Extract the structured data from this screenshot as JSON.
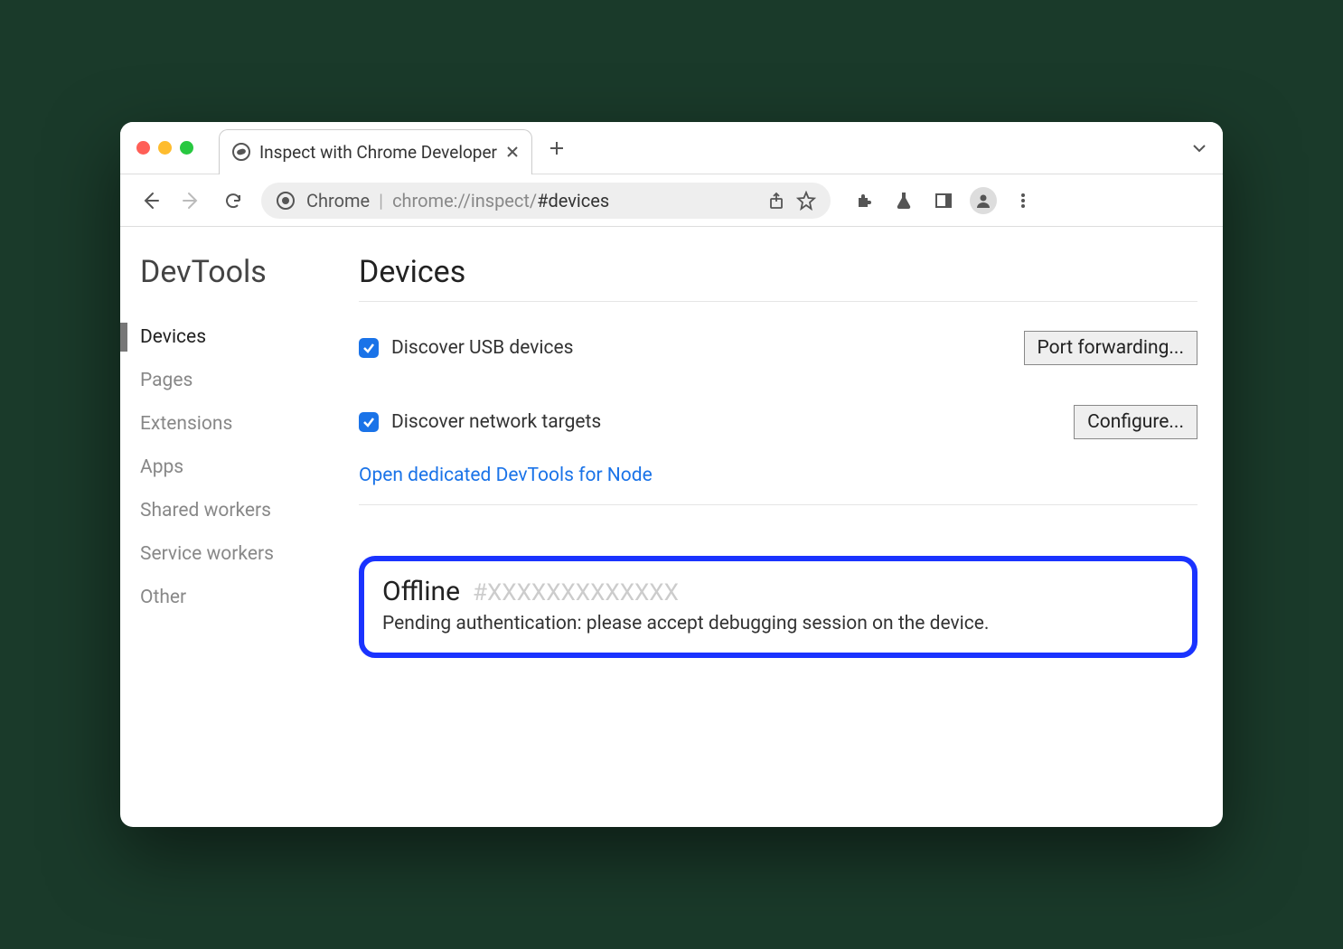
{
  "tab": {
    "title": "Inspect with Chrome Developer"
  },
  "omnibox": {
    "label": "Chrome",
    "url_main": "chrome://inspect/",
    "url_hash": "#devices"
  },
  "sidebar": {
    "title": "DevTools",
    "items": [
      {
        "label": "Devices",
        "active": true
      },
      {
        "label": "Pages"
      },
      {
        "label": "Extensions"
      },
      {
        "label": "Apps"
      },
      {
        "label": "Shared workers"
      },
      {
        "label": "Service workers"
      },
      {
        "label": "Other"
      }
    ]
  },
  "main": {
    "title": "Devices",
    "discover_usb": {
      "label": "Discover USB devices",
      "checked": true,
      "button": "Port forwarding..."
    },
    "discover_network": {
      "label": "Discover network targets",
      "checked": true,
      "button": "Configure..."
    },
    "node_link": "Open dedicated DevTools for Node",
    "offline": {
      "title": "Offline",
      "hash": "#XXXXXXXXXXXXX",
      "message": "Pending authentication: please accept debugging session on the device."
    }
  }
}
